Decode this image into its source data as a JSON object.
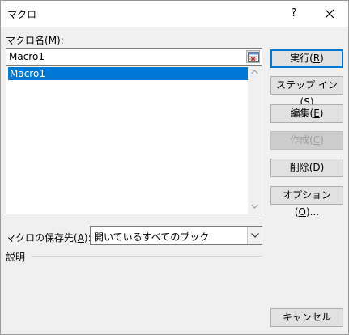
{
  "window": {
    "title": "マクロ",
    "help_label": "?",
    "close_icon": "close-icon"
  },
  "macro_name": {
    "label_pre": "マクロ名(",
    "label_key": "M",
    "label_post": "):",
    "value": "Macro1",
    "collapse_icon": "collapse-dialog-icon"
  },
  "macro_list": {
    "items": [
      {
        "label": "Macro1",
        "selected": true
      }
    ]
  },
  "buttons": {
    "run": {
      "pre": "実行(",
      "key": "R",
      "post": ")"
    },
    "step": {
      "pre": "ステップ イン(",
      "key": "S",
      "post": ")"
    },
    "edit": {
      "pre": "編集(",
      "key": "E",
      "post": ")"
    },
    "create": {
      "pre": "作成(",
      "key": "C",
      "post": ")"
    },
    "delete": {
      "pre": "削除(",
      "key": "D",
      "post": ")"
    },
    "options": {
      "pre": "オプション(",
      "key": "O",
      "post": ")..."
    },
    "cancel": {
      "label": "キャンセル"
    }
  },
  "store_in": {
    "label_pre": "マクロの保存先(",
    "label_key": "A",
    "label_post": "):",
    "selected": "開いているすべてのブック"
  },
  "description": {
    "label": "説明"
  },
  "colors": {
    "selection": "#0078d7",
    "default_button_border": "#0078d7"
  }
}
